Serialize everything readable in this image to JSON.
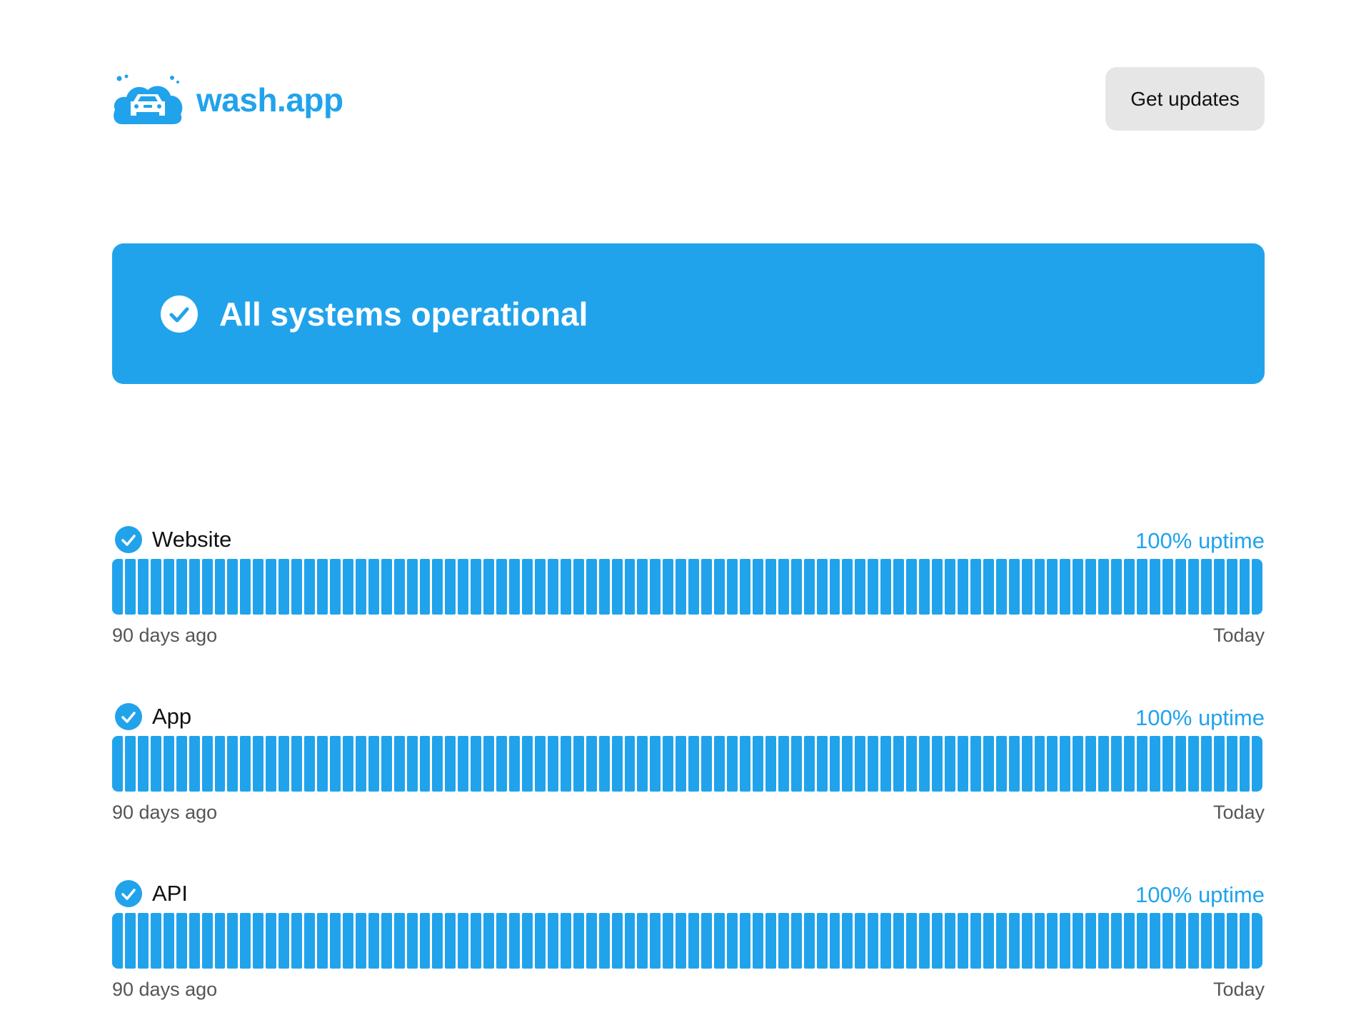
{
  "header": {
    "brand_name": "wash.app",
    "updates_label": "Get updates"
  },
  "banner": {
    "status_text": "All systems operational"
  },
  "colors": {
    "accent": "#21a3ec",
    "button_bg": "#e6e6e6"
  },
  "services": [
    {
      "name": "Website",
      "uptime": "100% uptime",
      "start_label": "90 days ago",
      "end_label": "Today",
      "days": 90,
      "status": "operational"
    },
    {
      "name": "App",
      "uptime": "100% uptime",
      "start_label": "90 days ago",
      "end_label": "Today",
      "days": 90,
      "status": "operational"
    },
    {
      "name": "API",
      "uptime": "100% uptime",
      "start_label": "90 days ago",
      "end_label": "Today",
      "days": 90,
      "status": "operational"
    }
  ]
}
